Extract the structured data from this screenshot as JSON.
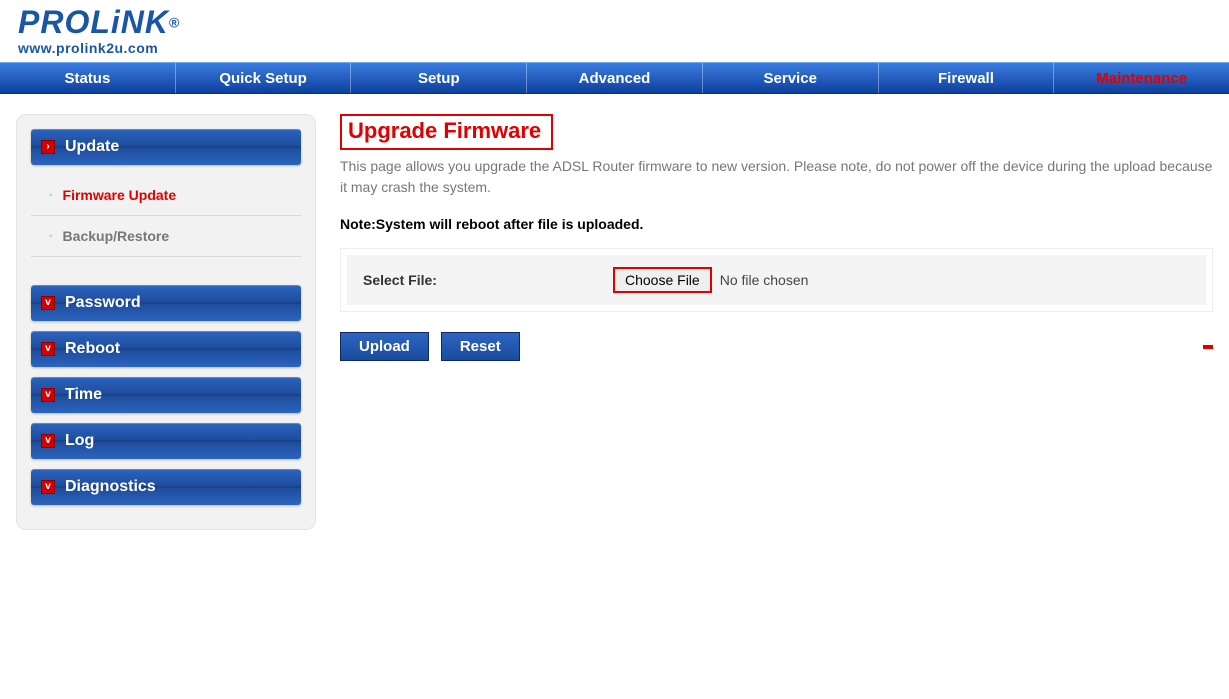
{
  "brand": {
    "name": "PROLiNK",
    "reg": "®",
    "url": "www.prolink2u.com"
  },
  "topnav": {
    "items": [
      {
        "label": "Status"
      },
      {
        "label": "Quick Setup"
      },
      {
        "label": "Setup"
      },
      {
        "label": "Advanced"
      },
      {
        "label": "Service"
      },
      {
        "label": "Firewall"
      },
      {
        "label": "Maintenance",
        "active": true
      }
    ]
  },
  "sidebar": {
    "sections": [
      {
        "label": "Update",
        "icon": "›",
        "sub": [
          {
            "label": "Firmware Update",
            "active": true
          },
          {
            "label": "Backup/Restore"
          }
        ]
      },
      {
        "label": "Password",
        "icon": "v"
      },
      {
        "label": "Reboot",
        "icon": "v"
      },
      {
        "label": "Time",
        "icon": "v"
      },
      {
        "label": "Log",
        "icon": "v"
      },
      {
        "label": "Diagnostics",
        "icon": "v"
      }
    ]
  },
  "page": {
    "title": "Upgrade Firmware",
    "description": "This page allows you upgrade the ADSL Router firmware to new version. Please note, do not power off the device during the upload because it may crash the system.",
    "note": "Note:System will reboot after file is uploaded.",
    "file_label": "Select File:",
    "choose_label": "Choose File",
    "file_status": "No file chosen",
    "upload_label": "Upload",
    "reset_label": "Reset"
  }
}
